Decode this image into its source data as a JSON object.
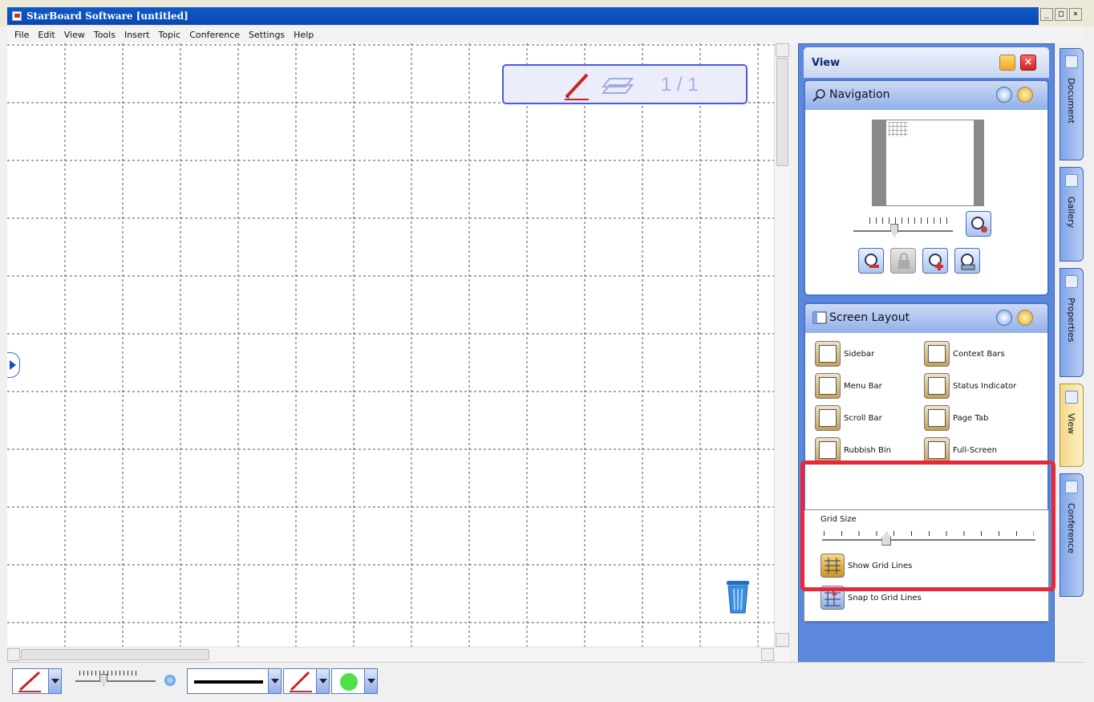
{
  "window": {
    "title": "StarBoard Software [untitled]",
    "buttons": [
      "_",
      "□",
      "×"
    ]
  },
  "menu": [
    "File",
    "Edit",
    "View",
    "Tools",
    "Insert",
    "Topic",
    "Conference",
    "Settings",
    "Help"
  ],
  "canvas": {
    "page_indicator": "1 / 1",
    "icons": {
      "pen": "pen-icon",
      "layers": "layers-icon",
      "trash": "trash-icon",
      "side_toggle": "expand-arrow-icon"
    }
  },
  "panel": {
    "title": "View",
    "navigation": {
      "title": "Navigation",
      "zoom_level": 0.35,
      "buttons": [
        "zoom-out-icon",
        "lock-icon",
        "zoom-in-icon",
        "fit-page-icon",
        "zoom-fit-icon"
      ]
    },
    "screen_layout": {
      "title": "Screen Layout",
      "items": [
        {
          "label": "Sidebar",
          "icon": "sidebar-icon"
        },
        {
          "label": "Context Bars",
          "icon": "context-bars-icon"
        },
        {
          "label": "Menu Bar",
          "icon": "menu-bar-icon"
        },
        {
          "label": "Status Indicator",
          "icon": "status-indicator-icon"
        },
        {
          "label": "Scroll Bar",
          "icon": "scroll-bar-icon"
        },
        {
          "label": "Page Tab",
          "icon": "page-tab-icon"
        },
        {
          "label": "Rubbish Bin",
          "icon": "rubbish-bin-icon"
        },
        {
          "label": "Full-Screen",
          "icon": "full-screen-icon"
        }
      ],
      "grid_size_label": "Grid Size",
      "grid_size_level": 0.28,
      "show_grid_lines": "Show Grid Lines",
      "snap_to_grid_lines": "Snap to Grid Lines"
    }
  },
  "tabs": [
    {
      "label": "Document",
      "icon": "document-icon"
    },
    {
      "label": "Gallery",
      "icon": "gallery-icon"
    },
    {
      "label": "Properties",
      "icon": "properties-icon"
    },
    {
      "label": "View",
      "icon": "view-icon"
    },
    {
      "label": "Conference",
      "icon": "conference-icon"
    }
  ],
  "bottom_toolbar": {
    "pen_width_level": 0.35,
    "colors": {
      "pen": "#c0282d",
      "fill": "#4fe04a",
      "accent": "#5b88dd",
      "highlight": "#e7283b"
    }
  }
}
